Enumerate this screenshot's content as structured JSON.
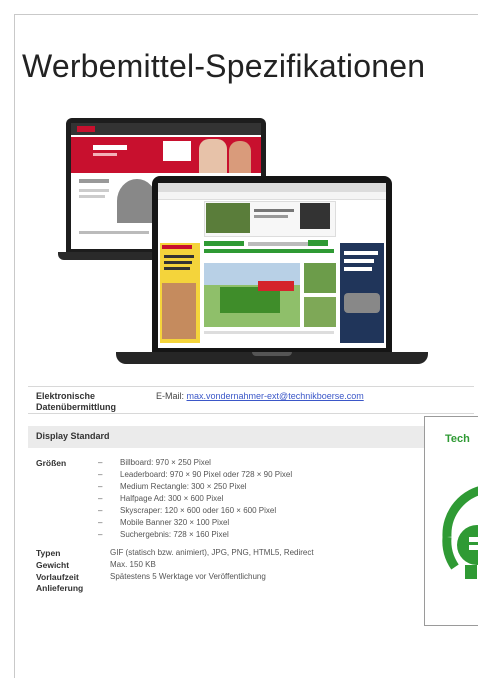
{
  "title": "Werbemittel-Spezifikationen",
  "electronic": {
    "label": "Elektronische Datenübermittlung",
    "email_prefix": "E-Mail: ",
    "email": "max.vondernahmer-ext@technikboerse.com"
  },
  "display_header": "Display Standard",
  "sizes": {
    "label": "Größen",
    "items": [
      "Billboard: 970 × 250 Pixel",
      "Leaderboard: 970 × 90 Pixel oder 728 × 90 Pixel",
      "Medium Rectangle: 300 × 250 Pixel",
      "Halfpage Ad: 300 × 600 Pixel",
      "Skyscraper: 120 × 600 oder 160 × 600 Pixel",
      "Mobile Banner 320 × 100 Pixel",
      "Suchergebnis: 728 × 160 Pixel"
    ]
  },
  "types": {
    "label": "Typen",
    "value": "GIF (statisch bzw. animiert), JPG, PNG, HTML5, Redirect"
  },
  "weight": {
    "label": "Gewicht",
    "value": "Max. 150 KB"
  },
  "lead": {
    "label": "Vorlaufzeit Anlieferung",
    "value": "Spätestens 5 Werktage vor Veröffentlichung"
  },
  "badge": {
    "text": "Tech"
  },
  "colors": {
    "green": "#2f9a34",
    "link": "#3b57c8",
    "header_bg": "#ebebeb"
  }
}
